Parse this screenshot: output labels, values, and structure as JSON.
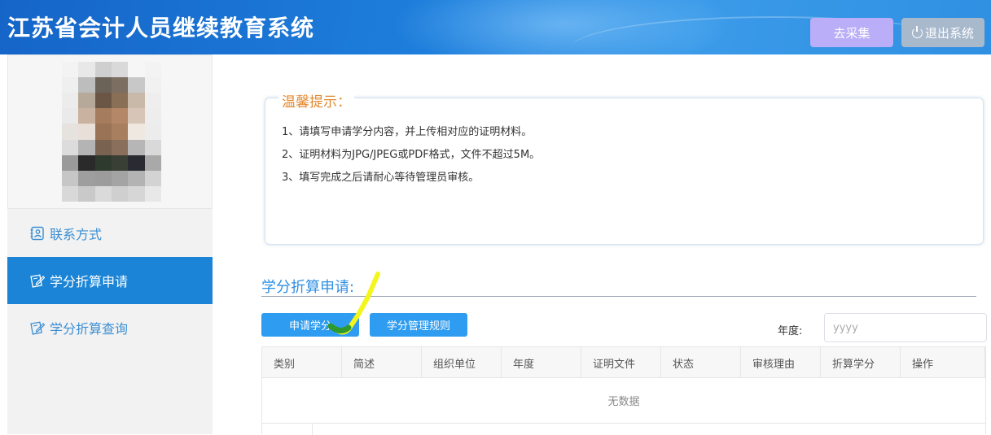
{
  "header": {
    "title": "江苏省会计人员继续教育系统",
    "collect_label": "去采集",
    "logout_label": "退出系统"
  },
  "sidebar": {
    "items": [
      {
        "label": "联系方式",
        "icon": "contact-card-icon",
        "active": false
      },
      {
        "label": "学分折算申请",
        "icon": "edit-certificate-icon",
        "active": true
      },
      {
        "label": "学分折算查询",
        "icon": "edit-certificate-icon",
        "active": false
      }
    ]
  },
  "tips": {
    "title": "温馨提示：",
    "lines": [
      "1、请填写申请学分内容，并上传相对应的证明材料。",
      "2、证明材料为JPG/JPEG或PDF格式，文件不超过5M。",
      "3、填写完成之后请耐心等待管理员审核。"
    ]
  },
  "section": {
    "title": "学分折算申请:",
    "apply_label": "申请学分",
    "rules_label": "学分管理规则",
    "year_label": "年度:",
    "year_placeholder": "yyyy"
  },
  "table": {
    "columns": [
      "类别",
      "简述",
      "组织单位",
      "年度",
      "证明文件",
      "状态",
      "审核理由",
      "折算学分",
      "操作"
    ],
    "empty_text": "无数据"
  },
  "colors": {
    "header_blue": "#1e7fdc",
    "active_nav": "#1b84d6",
    "link_blue": "#3b8fd4",
    "tip_orange": "#e3892f",
    "button_blue": "#2e9cf0",
    "collect_purple": "#b9aef7",
    "logout_gray": "#a8b9cc"
  }
}
